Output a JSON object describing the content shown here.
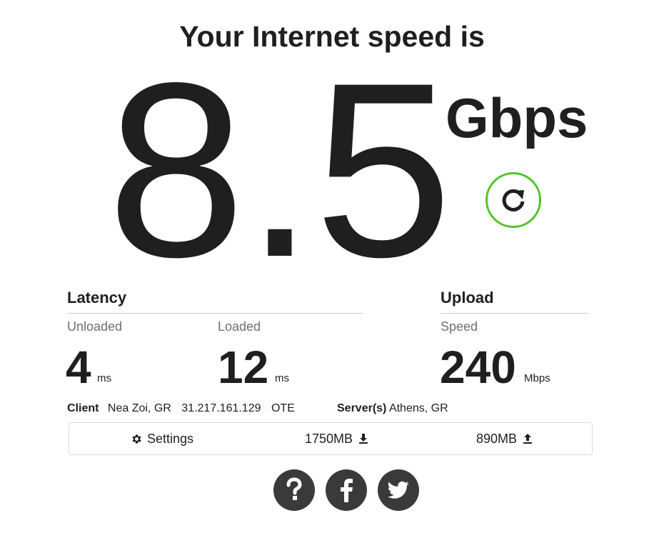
{
  "heading": "Your Internet speed is",
  "speed": {
    "value": "8.5",
    "units": "Gbps"
  },
  "latency": {
    "title": "Latency",
    "unloaded": {
      "label": "Unloaded",
      "value": "4",
      "unit": "ms"
    },
    "loaded": {
      "label": "Loaded",
      "value": "12",
      "unit": "ms"
    }
  },
  "upload": {
    "title": "Upload",
    "label": "Speed",
    "value": "240",
    "unit": "Mbps"
  },
  "info": {
    "client_label": "Client",
    "client_location": "Nea Zoi, GR",
    "client_ip": "31.217.161.129",
    "client_isp": "OTE",
    "server_label": "Server(s)",
    "server_location": "Athens, GR"
  },
  "bar": {
    "settings_label": "Settings",
    "download_amount": "1750MB",
    "upload_amount": "890MB"
  },
  "icons": {
    "refresh": "refresh-icon",
    "settings": "gear-icon",
    "download": "download-arrow-icon",
    "upload": "upload-arrow-icon",
    "help": "question-icon",
    "facebook": "facebook-icon",
    "twitter": "twitter-icon"
  },
  "colors": {
    "accent": "#51c42b",
    "text": "#1f1f1f",
    "muted": "#6f6f6f",
    "social_bg": "#3a3a3a"
  }
}
